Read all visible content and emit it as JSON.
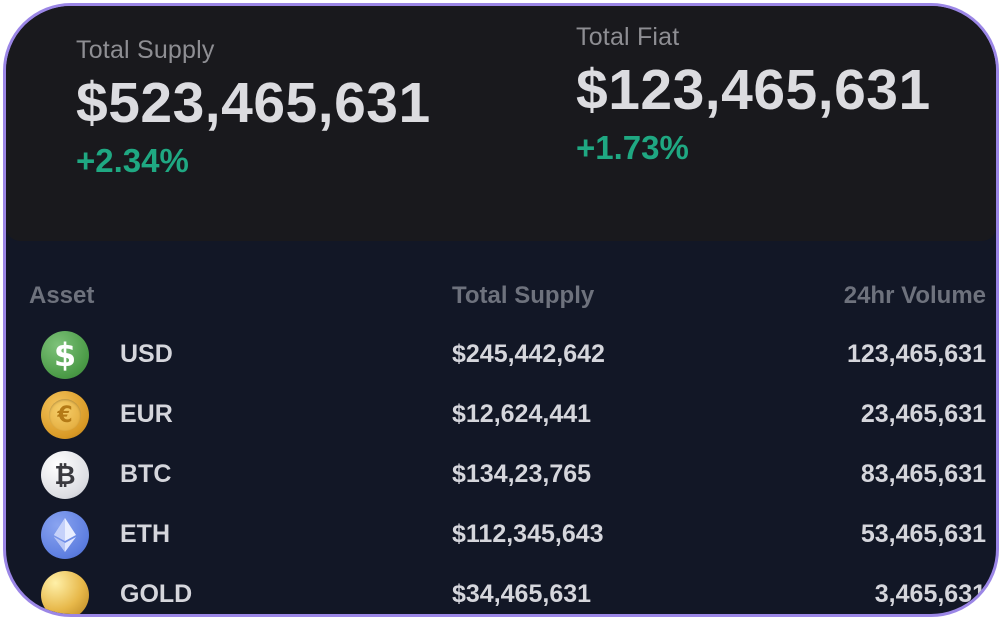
{
  "summary": {
    "total_supply": {
      "label": "Total Supply",
      "value": "$523,465,631",
      "change": "+2.34%"
    },
    "total_fiat": {
      "label": "Total Fiat",
      "value": "$123,465,631",
      "change": "+1.73%"
    }
  },
  "table": {
    "columns": {
      "asset": "Asset",
      "total_supply": "Total Supply",
      "volume_24h": "24hr Volume"
    },
    "rows": [
      {
        "icon": "usd-dollar-icon",
        "symbol": "USD",
        "total_supply": "$245,442,642",
        "volume_24h": "123,465,631"
      },
      {
        "icon": "eur-euro-icon",
        "symbol": "EUR",
        "total_supply": "$12,624,441",
        "volume_24h": "23,465,631"
      },
      {
        "icon": "btc-bitcoin-icon",
        "symbol": "BTC",
        "total_supply": "$134,23,765",
        "volume_24h": "83,465,631"
      },
      {
        "icon": "eth-ethereum-icon",
        "symbol": "ETH",
        "total_supply": "$112,345,643",
        "volume_24h": "53,465,631"
      },
      {
        "icon": "gold-coin-icon",
        "symbol": "GOLD",
        "total_supply": "$34,465,631",
        "volume_24h": "3,465,631"
      }
    ]
  },
  "colors": {
    "frame_border": "#9b86e6",
    "top_panel_bg": "#19191d",
    "table_bg": "#121726",
    "positive_change": "#1fa882",
    "primary_text": "#dcdce0",
    "muted_text": "#8e8e93"
  }
}
